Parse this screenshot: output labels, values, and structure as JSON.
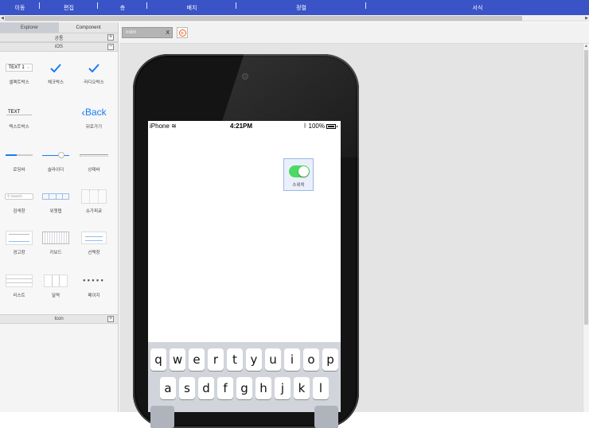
{
  "menu": [
    {
      "label": "이동"
    },
    {
      "label": "편집"
    },
    {
      "label": "층"
    },
    {
      "label": "배치"
    },
    {
      "label": "정렬"
    },
    {
      "label": "서식"
    }
  ],
  "left_panel": {
    "tabs": [
      "Explorer",
      "Component"
    ],
    "sections": {
      "common": "공통",
      "ios": "iOS",
      "icon": "Icon"
    },
    "toggle_plus": "+",
    "toggle_minus": "−",
    "components": [
      {
        "label": "셀렉트박스",
        "icon": "selectbox-icon",
        "text": "TEXT 1"
      },
      {
        "label": "체크박스",
        "icon": "checkmark-icon"
      },
      {
        "label": "라디오박스",
        "icon": "checkmark-icon"
      },
      {
        "label": "텍스트박스",
        "icon": "textbox-icon",
        "text": "TEXT"
      },
      {
        "label": "",
        "icon": "blank-icon"
      },
      {
        "label": "뒤로가기",
        "icon": "back-icon",
        "text": "Back"
      },
      {
        "label": "로딩바",
        "icon": "progress-bar-icon"
      },
      {
        "label": "슬라이더",
        "icon": "slider-icon"
      },
      {
        "label": "상태바",
        "icon": "status-bar-icon"
      },
      {
        "label": "검색창",
        "icon": "search-bar-icon",
        "text": "Search"
      },
      {
        "label": "위젯탭",
        "icon": "segmented-control-icon"
      },
      {
        "label": "슈가피쿄",
        "icon": "picker-icon"
      },
      {
        "label": "경고창",
        "icon": "alert-icon"
      },
      {
        "label": "키보드",
        "icon": "keyboard-icon"
      },
      {
        "label": "선택창",
        "icon": "action-sheet-icon"
      },
      {
        "label": "리스트",
        "icon": "list-icon"
      },
      {
        "label": "달력",
        "icon": "calendar-icon"
      },
      {
        "label": "페이지",
        "icon": "page-dots-icon"
      }
    ]
  },
  "doc_tab": {
    "name": "mdm",
    "close": "X",
    "add_icon": "add-circle-icon",
    "add_symbol": "+"
  },
  "phone": {
    "status": {
      "carrier": "iPhone",
      "time": "4:21PM",
      "battery": "100%"
    },
    "switch_component": {
      "label": "스위치",
      "state": "on"
    },
    "keyboard_rows": [
      [
        "q",
        "w",
        "e",
        "r",
        "t",
        "y",
        "u",
        "i",
        "o",
        "p"
      ],
      [
        "a",
        "s",
        "d",
        "f",
        "g",
        "h",
        "j",
        "k",
        "l"
      ]
    ]
  },
  "colors": {
    "menubar": "#3a53c6",
    "switch_on": "#4cd964",
    "ios_blue": "#1a7cf5",
    "add_icon": "#e8601c"
  }
}
